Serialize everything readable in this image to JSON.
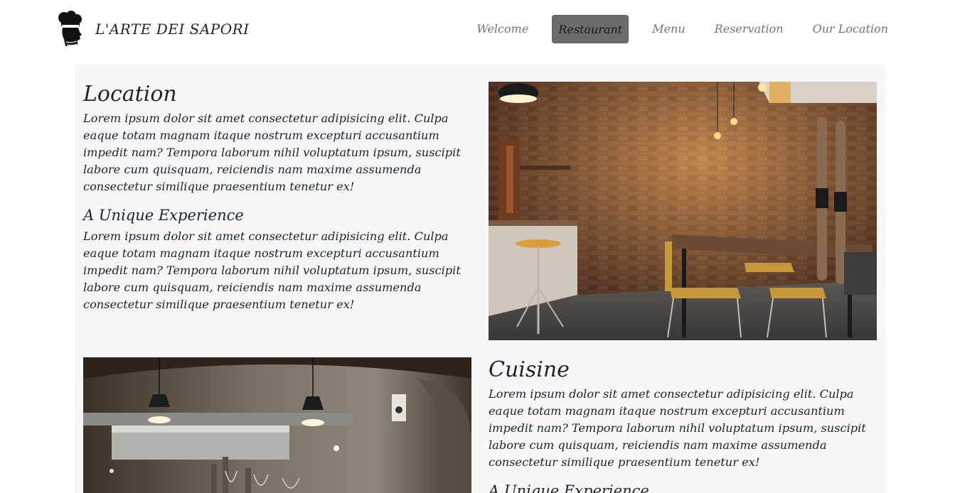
{
  "navbar": {
    "brand": "L'ARTE DEI SAPORI",
    "links": [
      {
        "label": "Welcome",
        "active": false
      },
      {
        "label": "Restaurant",
        "active": true
      },
      {
        "label": "Menu",
        "active": false
      },
      {
        "label": "Reservation",
        "active": false
      },
      {
        "label": "Our Location",
        "active": false
      }
    ]
  },
  "sections": {
    "location": {
      "title": "Location",
      "text": "Lorem ipsum dolor sit amet consectetur adipisicing elit. Culpa eaque totam magnam itaque nostrum excepturi accusantium impedit nam? Tempora laborum nihil voluptatum ipsum, suscipit labore cum quisquam, reiciendis nam maxime assumenda consectetur similique praesentium tenetur ex!",
      "subtitle": "A Unique Experience",
      "subtext": "Lorem ipsum dolor sit amet consectetur adipisicing elit. Culpa eaque totam magnam itaque nostrum excepturi accusantium impedit nam? Tempora laborum nihil voluptatum ipsum, suscipit labore cum quisquam, reiciendis nam maxime assumenda consectetur similique praesentium tenetur ex!"
    },
    "cuisine": {
      "title": "Cuisine",
      "text": "Lorem ipsum dolor sit amet consectetur adipisicing elit. Culpa eaque totam magnam itaque nostrum excepturi accusantium impedit nam? Tempora laborum nihil voluptatum ipsum, suscipit labore cum quisquam, reiciendis nam maxime assumenda consectetur similique praesentium tenetur ex!",
      "subtitle": "A Unique Experience"
    }
  },
  "colors": {
    "active_nav_bg": "#6c6c6c",
    "nav_text": "#6c757d",
    "content_bg": "#f6f7f9",
    "text": "#212529"
  }
}
